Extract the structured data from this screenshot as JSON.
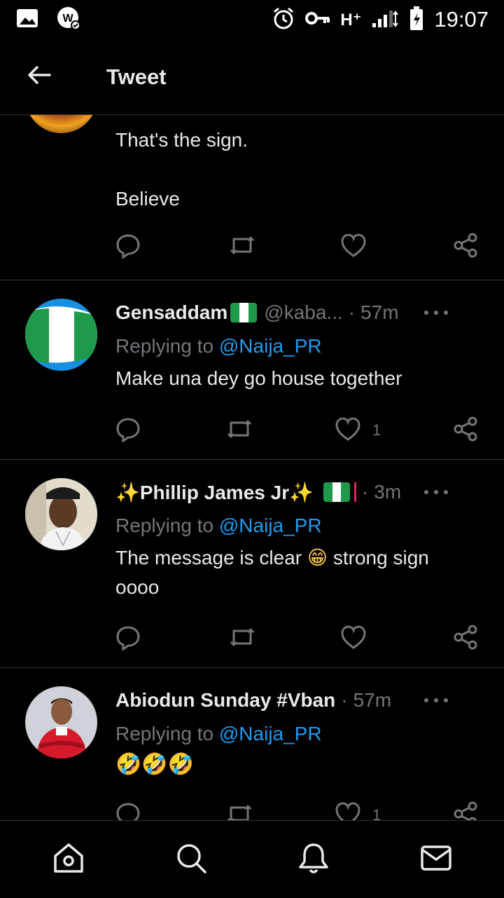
{
  "status_bar": {
    "time": "19:07",
    "network": "H⁺",
    "icons": [
      "gallery-icon",
      "whatsapp-business-icon",
      "alarm-icon",
      "vpn-key-icon",
      "signal-icon",
      "battery-charging-icon"
    ]
  },
  "header": {
    "title": "Tweet"
  },
  "tweets": [
    {
      "text_line1": "That's the sign.",
      "text_line2": "Believe"
    },
    {
      "name": "Gensaddam",
      "handle": "@kaba...",
      "time": "57m",
      "replying_prefix": "Replying to ",
      "replying_to": "@Naija_PR",
      "text": "Make una dey go house together",
      "like_count": "1"
    },
    {
      "name_prefix": "✨",
      "name": "Phillip James Jr",
      "name_suffix": "✨",
      "time": "3m",
      "replying_prefix": "Replying to ",
      "replying_to": "@Naija_PR",
      "text_part1": "The message is clear ",
      "emoji": "😁",
      "text_part2": " strong sign",
      "text_line2": "oooo"
    },
    {
      "name": "Abiodun Sunday #Vban",
      "time": "57m",
      "replying_prefix": "Replying to ",
      "replying_to": "@Naija_PR",
      "text": "🤣🤣🤣",
      "like_count": "1"
    }
  ],
  "nav": [
    "home-icon",
    "search-icon",
    "notifications-icon",
    "messages-icon"
  ],
  "colors": {
    "background": "#000000",
    "text": "#e7e9ea",
    "muted": "#71767b",
    "accent": "#1d9bf0",
    "divider": "#2f3336"
  }
}
